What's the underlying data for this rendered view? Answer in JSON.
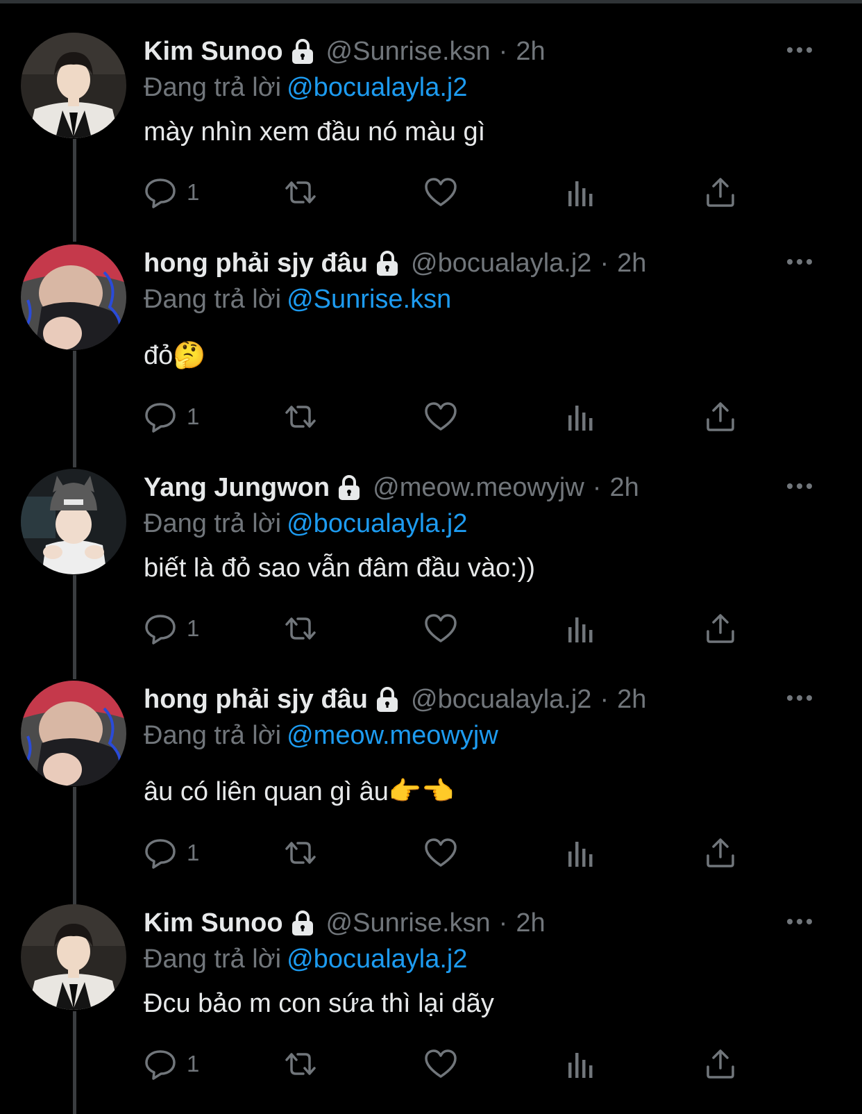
{
  "reply_prefix": "Đang trả lời",
  "tweets": [
    {
      "name": "Kim Sunoo",
      "handle": "@Sunrise.ksn",
      "time": "2h",
      "reply_to": "@bocualayla.j2",
      "text": "mày nhìn xem đầu nó màu gì",
      "reply_count": "1",
      "avatar": "kim-sunoo"
    },
    {
      "name": "hong phải sjy đâu",
      "handle": "@bocualayla.j2",
      "time": "2h",
      "reply_to": "@Sunrise.ksn",
      "text": "đỏ🤔",
      "reply_count": "1",
      "avatar": "red-beanie"
    },
    {
      "name": "Yang Jungwon",
      "handle": "@meow.meowyjw",
      "time": "2h",
      "reply_to": "@bocualayla.j2",
      "text": "biết là đỏ sao vẫn đâm đầu vào:))",
      "reply_count": "1",
      "avatar": "cat-beanie"
    },
    {
      "name": "hong phải sjy đâu",
      "handle": "@bocualayla.j2",
      "time": "2h",
      "reply_to": "@meow.meowyjw",
      "text": "âu có liên quan gì âu👉👈",
      "reply_count": "1",
      "avatar": "red-beanie"
    },
    {
      "name": "Kim Sunoo",
      "handle": "@Sunrise.ksn",
      "time": "2h",
      "reply_to": "@bocualayla.j2",
      "text": "Đcu bảo m con sứa thì lại dãy",
      "reply_count": "1",
      "avatar": "kim-sunoo"
    }
  ],
  "colors": {
    "background": "#000000",
    "text": "#e7e9ea",
    "muted": "#71767b",
    "mention": "#1d9bf0",
    "thread_line": "#3a3d40"
  },
  "icons": [
    "lock-icon",
    "more-icon",
    "reply-icon",
    "retweet-icon",
    "like-icon",
    "views-icon",
    "share-icon"
  ]
}
